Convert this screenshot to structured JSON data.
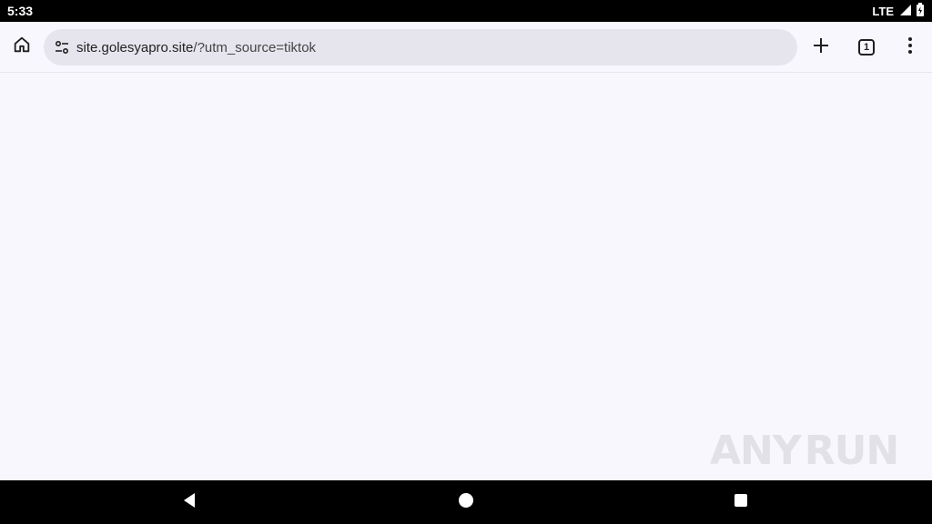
{
  "status_bar": {
    "time": "5:33",
    "network": "LTE",
    "icons": [
      "signal-icon",
      "battery-icon"
    ]
  },
  "browser": {
    "url_host": "site.golesyapro.site",
    "url_path": "/?utm_source=tiktok",
    "tab_count": "1",
    "icons": [
      "home-icon",
      "tune-icon",
      "plus-icon",
      "tab-switcher-icon",
      "more-vert-icon"
    ]
  },
  "watermark": {
    "left_text": "ANY",
    "right_text": "RUN"
  },
  "nav_bar": {
    "icons": [
      "back-icon",
      "home-circle-icon",
      "recents-icon"
    ]
  }
}
